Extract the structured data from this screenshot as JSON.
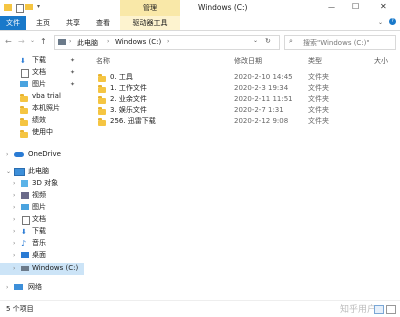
{
  "title_bar": {
    "context_group": "管理",
    "window_title": "Windows (C:)",
    "close_button": "✕",
    "minimize_button": "—",
    "maximize_button": "☐"
  },
  "ribbon": {
    "tabs": [
      "文件",
      "主页",
      "共享",
      "查看",
      "驱动器工具"
    ],
    "expand_icon": "chevron-down-icon",
    "help_icon": "question-icon"
  },
  "nav": {
    "breadcrumb": [
      "此电脑",
      "Windows (C:)"
    ],
    "search_placeholder": "搜索\"Windows (C:)\""
  },
  "sidebar": {
    "quick_access": [
      {
        "label": "下载",
        "icon": "download-icon",
        "pinned": true
      },
      {
        "label": "文档",
        "icon": "document-icon",
        "pinned": true
      },
      {
        "label": "图片",
        "icon": "picture-icon",
        "pinned": true
      },
      {
        "label": "vba trial",
        "icon": "folder-icon",
        "pinned": false
      },
      {
        "label": "本机照片",
        "icon": "folder-icon",
        "pinned": false
      },
      {
        "label": "绩效",
        "icon": "folder-icon",
        "pinned": false
      },
      {
        "label": "使用中",
        "icon": "folder-icon",
        "pinned": false
      }
    ],
    "onedrive": "OneDrive",
    "this_pc": "此电脑",
    "pc_items": [
      {
        "label": "3D 对象",
        "icon": "cube-icon"
      },
      {
        "label": "视频",
        "icon": "video-icon"
      },
      {
        "label": "图片",
        "icon": "picture-icon"
      },
      {
        "label": "文档",
        "icon": "document-icon"
      },
      {
        "label": "下载",
        "icon": "download-icon"
      },
      {
        "label": "音乐",
        "icon": "music-icon"
      },
      {
        "label": "桌面",
        "icon": "desktop-icon"
      },
      {
        "label": "Windows (C:)",
        "icon": "drive-icon"
      }
    ],
    "network": "网络"
  },
  "main": {
    "columns": [
      "名称",
      "修改日期",
      "类型",
      "大小"
    ],
    "rows": [
      {
        "name": "0. 工具",
        "date": "2020-2-10 14:45",
        "type": "文件夹"
      },
      {
        "name": "1. 工作文件",
        "date": "2020-2-3 19:34",
        "type": "文件夹"
      },
      {
        "name": "2. 业余文件",
        "date": "2020-2-11 11:51",
        "type": "文件夹"
      },
      {
        "name": "3. 娱乐文件",
        "date": "2020-2-7 1:31",
        "type": "文件夹"
      },
      {
        "name": "256. 迅雷下载",
        "date": "2020-2-12 9:08",
        "type": "文件夹"
      }
    ]
  },
  "status": {
    "count": "5 个项目"
  },
  "watermark": "知乎用户"
}
